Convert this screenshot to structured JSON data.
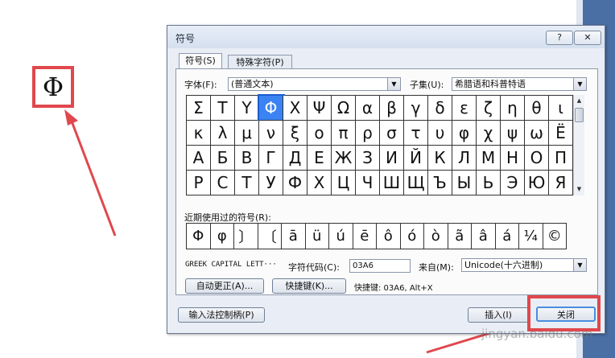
{
  "preview": {
    "char": "Φ"
  },
  "dialog": {
    "title": "符号",
    "help_label": "?",
    "close_label": "✕",
    "tabs": [
      {
        "label": "符号(S)"
      },
      {
        "label": "特殊字符(P)"
      }
    ],
    "font_label": "字体(F):",
    "font_value": "(普通文本)",
    "subset_label": "子集(U):",
    "subset_value": "希腊语和科普特语",
    "symbols": [
      "Σ",
      "Τ",
      "Υ",
      "Φ",
      "Χ",
      "Ψ",
      "Ω",
      "α",
      "β",
      "γ",
      "δ",
      "ε",
      "ζ",
      "η",
      "θ",
      "ι",
      "κ",
      "λ",
      "μ",
      "ν",
      "ξ",
      "ο",
      "π",
      "ρ",
      "σ",
      "τ",
      "υ",
      "φ",
      "χ",
      "ψ",
      "ω",
      "Ё",
      "А",
      "Б",
      "В",
      "Г",
      "Д",
      "Е",
      "Ж",
      "З",
      "И",
      "Й",
      "К",
      "Л",
      "М",
      "Н",
      "О",
      "П",
      "Р",
      "С",
      "Т",
      "У",
      "Ф",
      "Х",
      "Ц",
      "Ч",
      "Ш",
      "Щ",
      "Ъ",
      "Ы",
      "Ь",
      "Э",
      "Ю",
      "Я"
    ],
    "recent_label": "近期使用过的符号(R):",
    "recent": [
      "Φ",
      "φ",
      "〕",
      "〔",
      "ā",
      "ü",
      "ú",
      "ē",
      "ô",
      "ó",
      "ò",
      "ã",
      "â",
      "á",
      "¼",
      "©"
    ],
    "char_name": "GREEK CAPITAL LETT···",
    "char_code_label": "字符代码(C):",
    "char_code_value": "03A6",
    "from_label": "来自(M):",
    "from_value": "Unicode(十六进制)",
    "autocorrect_label": "自动更正(A)...",
    "shortcut_btn_label": "快捷键(K)...",
    "shortcut_text": "快捷键: 03A6, Alt+X",
    "ime_label": "输入法控制柄(P)",
    "insert_label": "插入(I)",
    "close_btn_label": "关闭"
  },
  "watermark": "jingyan.baidu.com",
  "colors": {
    "highlight": "#e0484d",
    "selection": "#3b83f3"
  }
}
